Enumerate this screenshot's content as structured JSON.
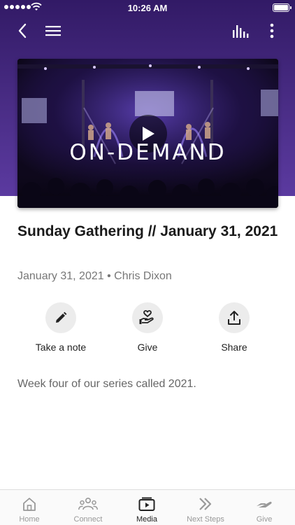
{
  "status_bar": {
    "time": "10:26 AM"
  },
  "nav": {
    "back_icon": "chevron-left-icon",
    "menu_icon": "hamburger-icon",
    "audio_icon": "audio-bars-icon",
    "more_icon": "more-vertical-icon"
  },
  "hero": {
    "color": "#4a2d86"
  },
  "video": {
    "caption": "ON-DEMAND",
    "play_icon": "play-icon"
  },
  "content": {
    "title": "Sunday Gathering // January 31, 2021",
    "meta": "January 31, 2021 • Chris Dixon",
    "description": "Week four of our series called 2021."
  },
  "actions": [
    {
      "label": "Take a note",
      "icon": "pencil-icon"
    },
    {
      "label": "Give",
      "icon": "hand-heart-icon"
    },
    {
      "label": "Share",
      "icon": "share-icon"
    }
  ],
  "tabs": [
    {
      "label": "Home",
      "icon": "home-icon",
      "active": false
    },
    {
      "label": "Connect",
      "icon": "people-icon",
      "active": false
    },
    {
      "label": "Media",
      "icon": "media-icon",
      "active": true
    },
    {
      "label": "Next Steps",
      "icon": "double-chevron-icon",
      "active": false
    },
    {
      "label": "Give",
      "icon": "giving-hand-icon",
      "active": false
    }
  ],
  "colors": {
    "accent": "#4a2d86",
    "tab_inactive": "#999999",
    "tab_active": "#222222"
  }
}
